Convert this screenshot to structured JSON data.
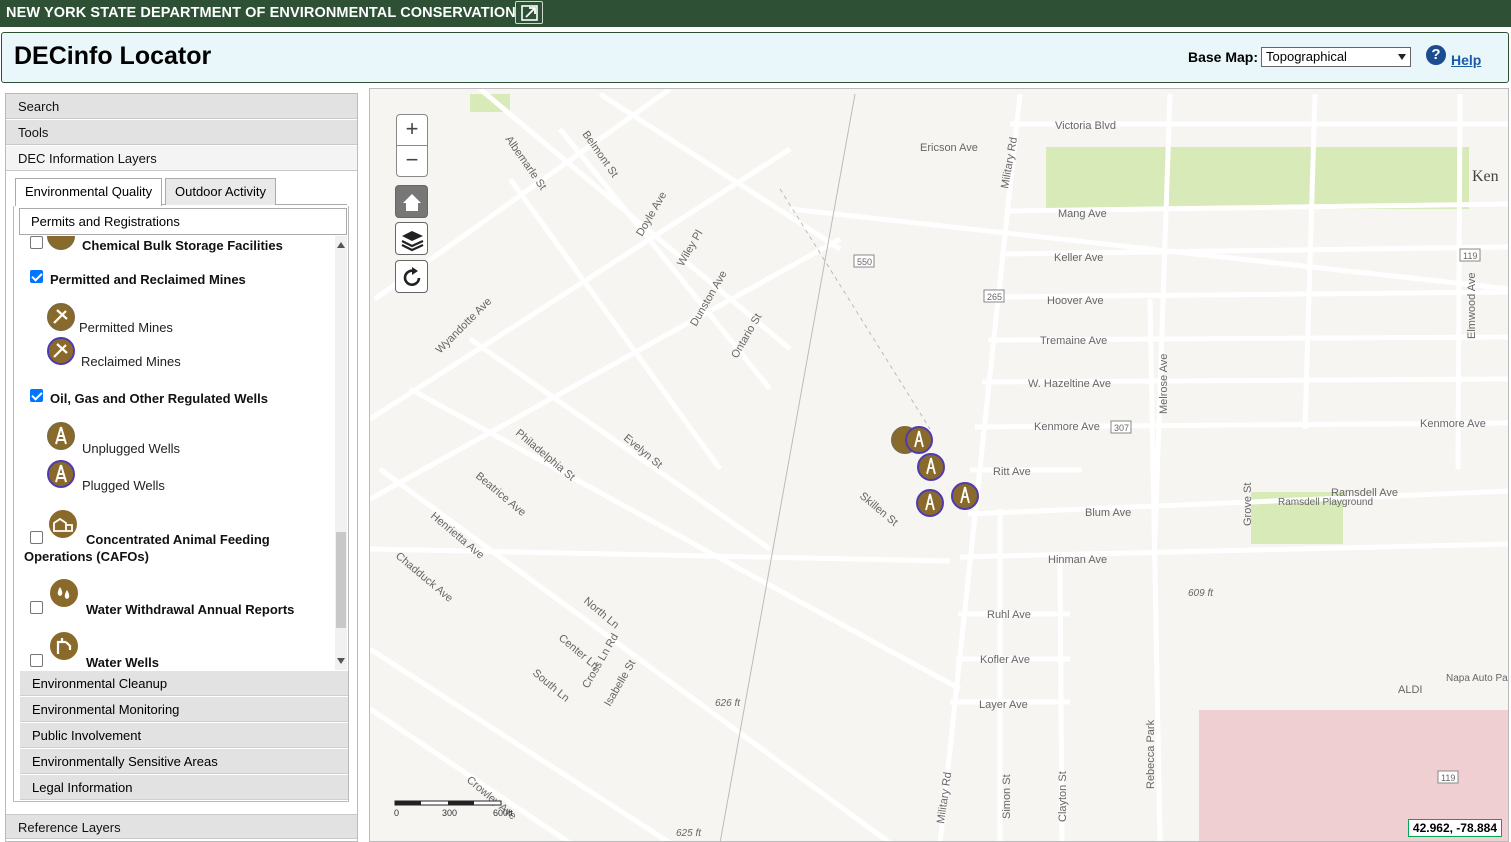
{
  "topbar": {
    "agency": "NEW YORK STATE DEPARTMENT OF ENVIRONMENTAL CONSERVATION",
    "export_icon": "external-link-icon"
  },
  "header": {
    "title": "DECinfo Locator",
    "basemap_label": "Base Map:",
    "basemap_value": "Topographical",
    "help_icon_glyph": "?",
    "help_label": "Help"
  },
  "sidebar": {
    "sections": [
      "Search",
      "Tools",
      "DEC Information Layers"
    ],
    "tabs": [
      "Environmental Quality",
      "Outdoor Activity"
    ],
    "subheader": "Permits and Registrations",
    "layers": [
      {
        "label": "Chemical Bulk Storage Facilities",
        "checked": false
      },
      {
        "label": "Permitted and Reclaimed Mines",
        "checked": true,
        "legend": [
          "Permitted Mines",
          "Reclaimed Mines"
        ]
      },
      {
        "label": "Oil, Gas and Other Regulated Wells",
        "checked": true,
        "legend": [
          "Unplugged Wells",
          "Plugged Wells"
        ]
      },
      {
        "label": "Concentrated Animal Feeding",
        "label2": "Operations (CAFOs)",
        "checked": false
      },
      {
        "label": "Water Withdrawal Annual Reports",
        "checked": false
      },
      {
        "label": "Water Wells",
        "checked": false
      }
    ],
    "subsections": [
      "Environmental Cleanup",
      "Environmental Monitoring",
      "Public Involvement",
      "Environmentally Sensitive Areas",
      "Legal Information"
    ],
    "reference": "Reference Layers"
  },
  "map": {
    "zoom_in": "+",
    "zoom_out": "−",
    "scale_labels": [
      "0",
      "300",
      "600ft"
    ],
    "coords": "42.962, -78.884",
    "streets": [
      "Victoria Blvd",
      "Ericson Ave",
      "Military Rd",
      "Mang Ave",
      "Keller Ave",
      "Hoover Ave",
      "Tremaine Ave",
      "W. Hazeltine Ave",
      "Kenmore Ave",
      "Ritt Ave",
      "Blum Ave",
      "Ramsdell Ave",
      "Hinman Ave",
      "Ruhl Ave",
      "Kofler Ave",
      "Layer Ave",
      "Melrose Ave",
      "Grove St",
      "Elmwood Ave",
      "Albemarle St",
      "Belmont St",
      "Doyle Ave",
      "Wiley Pl",
      "Dunston Ave",
      "Ontario St",
      "Wyandotte Ave",
      "Philadelphia St",
      "Evelyn St",
      "Skillen St",
      "Beatrice Ave",
      "Henrietta Ave",
      "Chadduck Ave",
      "North Ln",
      "Center Ln",
      "Cross Ln Rd",
      "South Ln",
      "Isabelle St",
      "Crowley Ave",
      "Simon St",
      "Clayton St",
      "Rebecca Park",
      "Military Rd",
      "Kenmore Ave"
    ],
    "shields": [
      "550",
      "265",
      "307",
      "119",
      "119"
    ],
    "places": [
      "Ken",
      "Ramsdell Playground",
      "ALDI",
      "Napa Auto Parts"
    ],
    "elevations": [
      "609 ft",
      "626 ft",
      "625 ft"
    ]
  }
}
